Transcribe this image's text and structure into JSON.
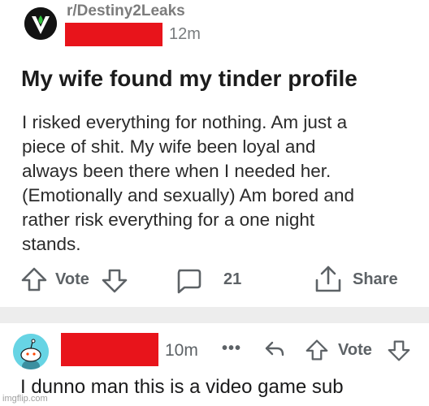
{
  "post": {
    "subreddit": "r/Destiny2Leaks",
    "time": "12m",
    "title": "My wife found my tinder profile",
    "body_lines": [
      "I risked everything for nothing. Am just a",
      "piece of shit. My wife been loyal and",
      "always been there when I needed her.",
      "(Emotionally and sexually) Am bored and",
      "rather risk everything for a one night",
      "stands."
    ],
    "actions": {
      "vote_label": "Vote",
      "comment_count": "21",
      "share_label": "Share"
    }
  },
  "comment": {
    "time": "10m",
    "more": "•••",
    "vote_label": "Vote",
    "text": "I dunno man this is a video game sub"
  },
  "watermark": "imgflip.com",
  "colors": {
    "redaction": "#e8141b",
    "subreddit_icon_bg": "#131313",
    "subreddit_icon_fg": "#2fbf3a",
    "comment_avatar_bg": "#67d4e4",
    "divider": "#ededed",
    "muted_text": "#5d6266"
  },
  "icons": [
    "destiny-subreddit-icon",
    "upvote-arrow-icon",
    "downvote-arrow-icon",
    "comment-bubble-icon",
    "share-icon",
    "reply-arrow-icon",
    "snoo-avatar-icon"
  ]
}
